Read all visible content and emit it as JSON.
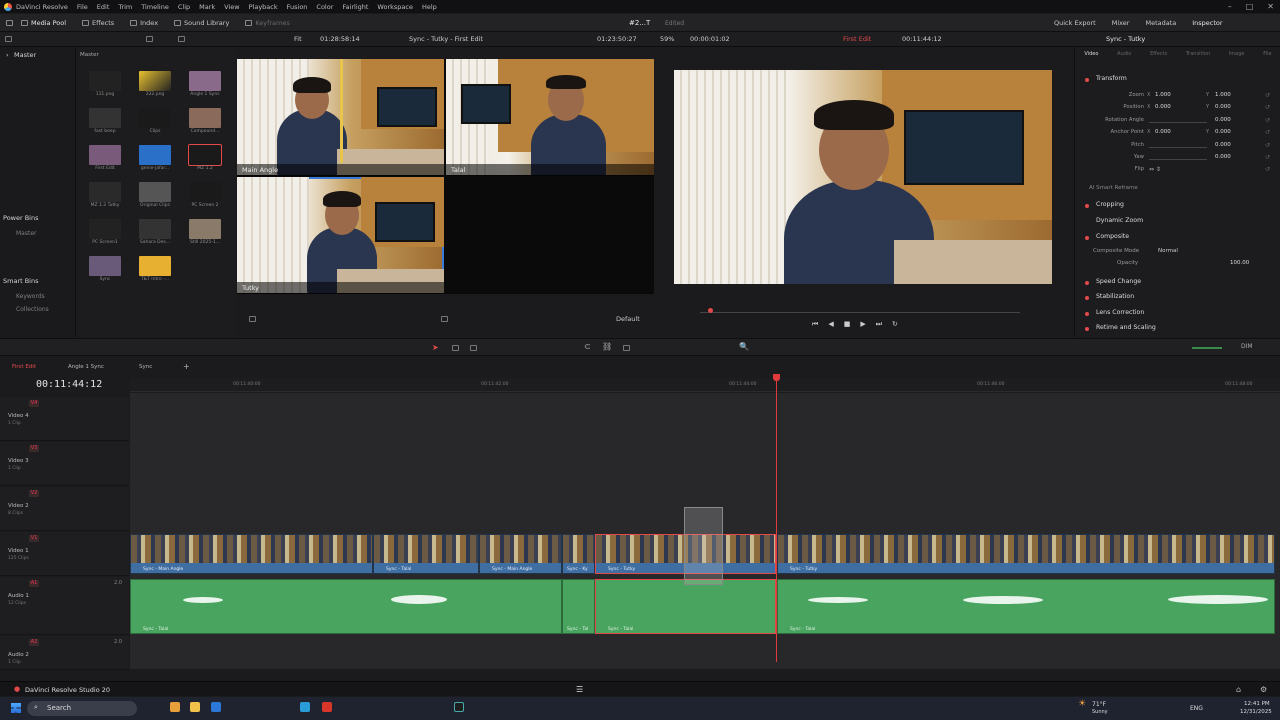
{
  "menu": {
    "app": "DaVinci Resolve",
    "items": [
      "File",
      "Edit",
      "Trim",
      "Timeline",
      "Clip",
      "Mark",
      "View",
      "Playback",
      "Fusion",
      "Color",
      "Fairlight",
      "Workspace",
      "Help"
    ]
  },
  "window": {
    "project": "#2...T",
    "status": "Edited"
  },
  "toolbar": {
    "left": [
      "Media Pool",
      "Effects",
      "Index",
      "Sound Library",
      "Keyframes"
    ],
    "right": [
      "Quick Export",
      "Mixer",
      "Metadata",
      "Inspector"
    ]
  },
  "subbar": {
    "fit": "Fit",
    "src_tc": "01:28:58:14",
    "title": "Sync - Tutky - First Edit",
    "rec_tc": "01:23:50:27",
    "zoom": "59%",
    "dur": "00:00:01:02",
    "tl_name": "First Edit",
    "tl_tc": "00:11:44:12",
    "insp_title": "Sync - Tutky"
  },
  "left_panel": {
    "master": "Master",
    "power_bins": "Power Bins",
    "pb_master": "Master",
    "smart_bins": "Smart Bins",
    "keywords": "Keywords",
    "collections": "Collections"
  },
  "pool": {
    "header": "Master",
    "items": [
      "111.png",
      "222.png",
      "Angle 1 Sync",
      "fast beep",
      "Clips",
      "Compound...",
      "First Edit",
      "genie-jafar...",
      "MZ 1.2",
      "MZ 1.2 Tutky",
      "Original Clips",
      "PC Screen 2",
      "PC Screen1",
      "Sahara Des...",
      "Still 2025-1...",
      "Sync",
      "T&T Intro -..."
    ]
  },
  "multicam": {
    "angles": [
      "Main Angle",
      "Talal",
      "Tutky"
    ],
    "default": "Default"
  },
  "inspector": {
    "tabs": [
      "Video",
      "Audio",
      "Effects",
      "Transition",
      "Image",
      "File"
    ],
    "transform": "Transform",
    "rows": [
      {
        "label": "Zoom",
        "x": "1.000",
        "y": "1.000"
      },
      {
        "label": "Position",
        "x": "0.000",
        "y": "0.000"
      },
      {
        "label": "Rotation Angle",
        "v": "0.000"
      },
      {
        "label": "Anchor Point",
        "x": "0.000",
        "y": "0.000"
      },
      {
        "label": "Pitch",
        "v": "0.000"
      },
      {
        "label": "Yaw",
        "v": "0.000"
      },
      {
        "label": "Flip"
      }
    ],
    "sections": [
      "AI Smart Reframe",
      "Cropping",
      "Dynamic Zoom",
      "Composite",
      "Speed Change",
      "Stabilization",
      "Lens Correction",
      "Retime and Scaling"
    ],
    "composite_mode_label": "Composite Mode",
    "composite_mode": "Normal",
    "opacity_label": "Opacity",
    "opacity": "100.00"
  },
  "timeline": {
    "tabs": [
      "First Edit",
      "Angle 1 Sync",
      "Sync"
    ],
    "timecode": "00:11:44:12",
    "ruler": [
      "00:11:40:00",
      "00:11:42:00",
      "00:11:44:00",
      "00:11:46:00",
      "00:11:48:00"
    ],
    "tracks": [
      {
        "id": "V4",
        "name": "Video 4",
        "clips": "1 Clip"
      },
      {
        "id": "V3",
        "name": "Video 3",
        "clips": "1 Clip"
      },
      {
        "id": "V2",
        "name": "Video 2",
        "clips": "8 Clips"
      },
      {
        "id": "V1",
        "name": "Video 1",
        "clips": "125 Clips"
      },
      {
        "id": "A1",
        "name": "Audio 1",
        "clips": "12 Clips",
        "level": "2.0"
      },
      {
        "id": "A2",
        "name": "Audio 2",
        "clips": "1 Clip",
        "level": "2.0"
      }
    ],
    "video_clips": [
      "Sync - Main Angle",
      "Sync - Talal",
      "Sync - Main Angle",
      "Sync - Ky",
      "Sync - Tutky",
      "Sync - Tutky"
    ],
    "audio_clips": [
      "Sync - Talal",
      "Sync - Tal",
      "Sync - Talal",
      "Sync - Talal"
    ]
  },
  "pagebar": {
    "app": "DaVinci Resolve Studio 20"
  },
  "taskbar": {
    "search": "Search",
    "weather_temp": "71°F",
    "weather": "Sunny",
    "lang": "ENG",
    "time": "12:41 PM",
    "date": "12/31/2025"
  },
  "volume_label": "DIM"
}
